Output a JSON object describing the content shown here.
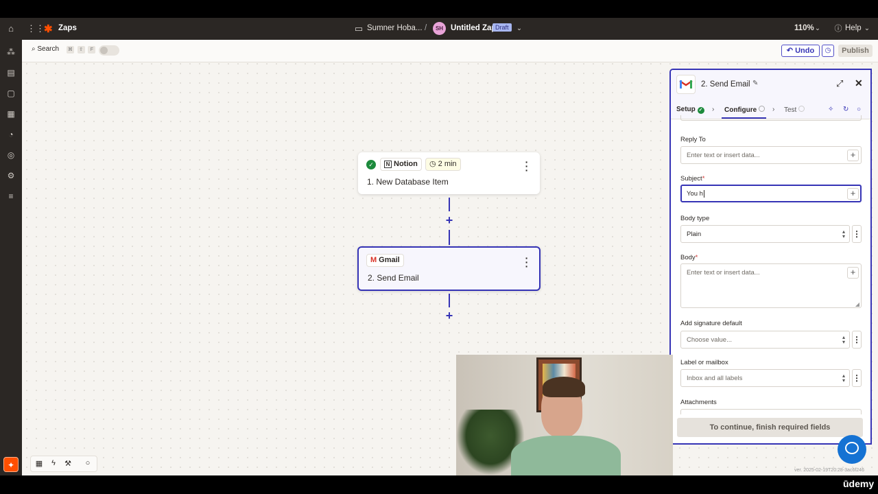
{
  "topbar": {
    "zaps_label": "Zaps",
    "folder_name": "Sumner Hoba...",
    "separator": "/",
    "avatar_initials": "SH",
    "zap_name": "Untitled Zap",
    "draft_badge": "Draft",
    "zoom": "110%",
    "help": "Help"
  },
  "toolbar": {
    "search_label": "Search",
    "shortcut_keys": [
      "⌘",
      "⇧",
      "F"
    ],
    "undo_label": "Undo",
    "publish_label": "Publish"
  },
  "nodes": [
    {
      "app": "Notion",
      "badge": "2 min",
      "title": "1. New Database Item"
    },
    {
      "app": "Gmail",
      "title": "2. Send Email"
    }
  ],
  "panel": {
    "title": "2. Send Email",
    "tabs": {
      "setup": "Setup",
      "configure": "Configure",
      "test": "Test"
    },
    "fields": {
      "reply_to": {
        "label": "Reply To",
        "placeholder": "Enter text or insert data..."
      },
      "subject": {
        "label": "Subject",
        "required": "*",
        "value": "You h"
      },
      "body_type": {
        "label": "Body type",
        "value": "Plain"
      },
      "body": {
        "label": "Body",
        "required": "*",
        "placeholder": "Enter text or insert data..."
      },
      "signature": {
        "label": "Add signature default",
        "value": "Choose value..."
      },
      "label_mailbox": {
        "label": "Label or mailbox",
        "value": "Inbox and all labels"
      },
      "attachments": {
        "label": "Attachments"
      }
    },
    "continue_label": "To continue, finish required fields"
  },
  "footer": {
    "version": "ver. 2025-02-19T20:28-3ac6f246",
    "udemy": "ūdemy"
  },
  "colors": {
    "accent": "#3533b5",
    "brand": "#ff4f00",
    "canvas": "#f6f4f0"
  }
}
